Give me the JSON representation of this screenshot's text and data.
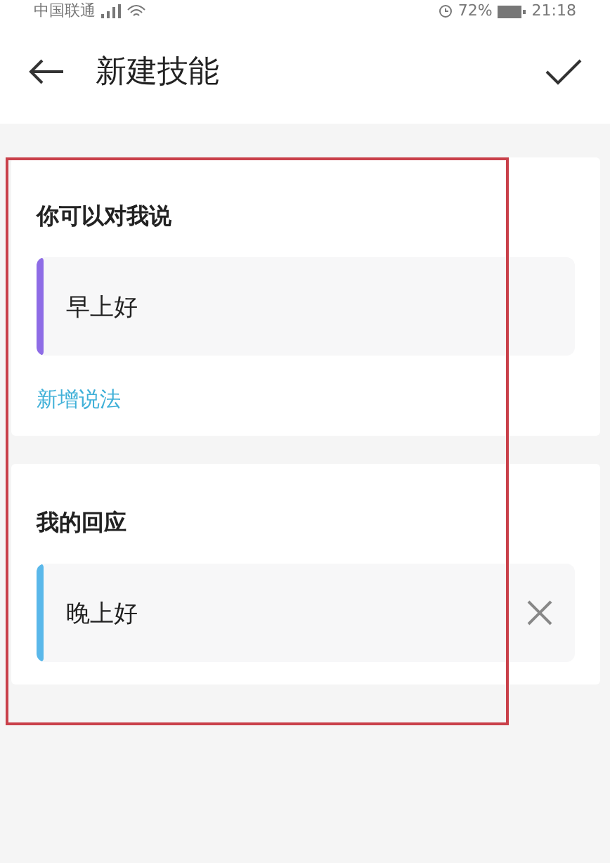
{
  "status_bar": {
    "carrier": "中国联通",
    "battery": "72%",
    "time": "21:18"
  },
  "header": {
    "title": "新建技能"
  },
  "cards": [
    {
      "title": "你可以对我说",
      "value": "早上好",
      "color": "#8e6ce6",
      "clearable": false,
      "add_link": "新增说法"
    },
    {
      "title": "我的回应",
      "value": "晚上好",
      "color": "#5ab8ea",
      "clearable": true
    }
  ]
}
